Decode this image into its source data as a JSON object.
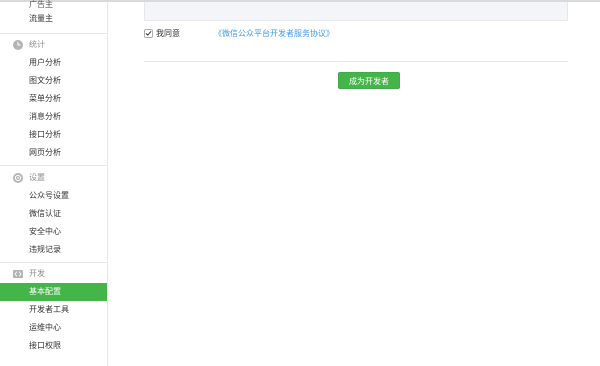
{
  "sidebar": {
    "partial_items": [
      "广告主",
      "流量主"
    ],
    "sections": [
      {
        "title": "统计",
        "icon": "clock-icon",
        "items": [
          "用户分析",
          "图文分析",
          "菜单分析",
          "消息分析",
          "接口分析",
          "网页分析"
        ]
      },
      {
        "title": "设置",
        "icon": "gear-icon",
        "items": [
          "公众号设置",
          "微信认证",
          "安全中心",
          "违规记录"
        ]
      },
      {
        "title": "开发",
        "icon": "code-icon",
        "items": [
          "基本配置",
          "开发者工具",
          "运维中心",
          "接口权限"
        ],
        "active_item": "基本配置"
      }
    ]
  },
  "main": {
    "agreement": {
      "checked": true,
      "text": "我同意",
      "link_text": "《微信公众平台开发者服务协议》"
    },
    "submit_label": "成为开发者"
  },
  "colors": {
    "accent": "#44b549",
    "link": "#459ae9",
    "border": "#e7e7eb",
    "muted": "#8d8d8d"
  }
}
